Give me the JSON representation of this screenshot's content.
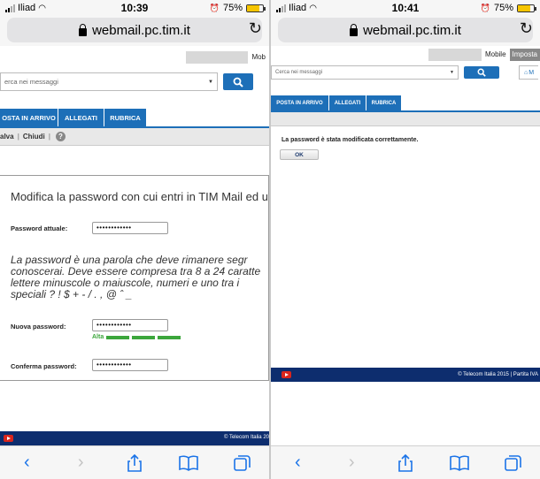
{
  "left": {
    "status": {
      "carrier": "Iliad",
      "time": "10:39",
      "battery": "75%"
    },
    "url": "webmail.pc.tim.it",
    "top_strip_label": "Mob",
    "search_placeholder": "erca nei messaggi",
    "tabs": [
      "OSTA IN ARRIVO",
      "ALLEGATI",
      "RUBRICA"
    ],
    "toolbar": {
      "save": "alva",
      "close": "Chiudi",
      "help": "?"
    },
    "form": {
      "title": "Modifica la password con cui entri in TIM Mail ed utili",
      "current_label": "Password attuale:",
      "current_value": "••••••••••••",
      "info": "La password è una parola che deve rimanere segr conoscerai. Deve essere compresa tra 8 a 24 caratte lettere minuscole o maiuscole, numeri e uno tra i speciali ? ! $ + - / . , @ ˆ _",
      "new_label": "Nuova password:",
      "new_value": "••••••••••••",
      "strength_label": "Alta",
      "strength_fraction": 1.0,
      "confirm_label": "Conferma password:",
      "confirm_value": "••••••••••••"
    },
    "footer_text": "© Telecom Italia 20"
  },
  "right": {
    "status": {
      "carrier": "Iliad",
      "time": "10:41",
      "battery": "75%"
    },
    "url": "webmail.pc.tim.it",
    "top_strip": {
      "mobile": "Mobile",
      "settings": "Imposta"
    },
    "search_placeholder": "Cerca nei messaggi",
    "home_label": "M",
    "tabs": [
      "POSTA IN ARRIVO",
      "ALLEGATI",
      "RUBRICA"
    ],
    "message": "La password è stata modificata correttamente.",
    "ok_button": "OK",
    "footer_text": "© Telecom Italia 2015 | Partita IVA"
  },
  "colors": {
    "brand_blue": "#1d6fb8",
    "footer_navy": "#0d2d6e",
    "strength_green": "#3ca63c",
    "battery_yellow": "#f6c500"
  }
}
